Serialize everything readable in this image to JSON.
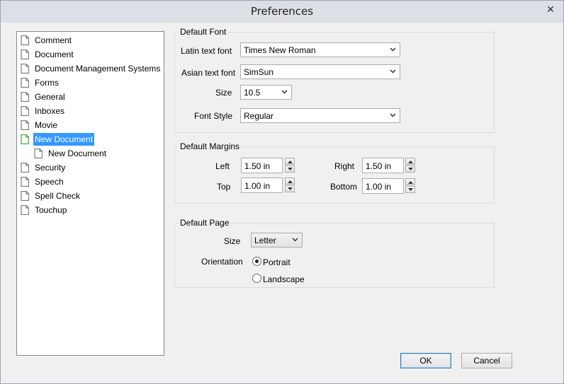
{
  "window": {
    "title": "Preferences",
    "close_glyph": "✕"
  },
  "tree": {
    "items": [
      {
        "label": "Comment"
      },
      {
        "label": "Document"
      },
      {
        "label": "Document Management Systems"
      },
      {
        "label": "Forms"
      },
      {
        "label": "General"
      },
      {
        "label": "Inboxes"
      },
      {
        "label": "Movie"
      },
      {
        "label": "New Document",
        "selected": true
      },
      {
        "label": "New Document",
        "child": true
      },
      {
        "label": "Security"
      },
      {
        "label": "Speech"
      },
      {
        "label": "Spell Check"
      },
      {
        "label": "Touchup"
      }
    ]
  },
  "default_font": {
    "legend": "Default Font",
    "latin_label": "Latin text font",
    "latin_value": "Times New Roman",
    "asian_label": "Asian text font",
    "asian_value": "SimSun",
    "size_label": "Size",
    "size_value": "10.5",
    "style_label": "Font Style",
    "style_value": "Regular"
  },
  "default_margins": {
    "legend": "Default Margins",
    "left_label": "Left",
    "left_value": "1.50 in",
    "right_label": "Right",
    "right_value": "1.50 in",
    "top_label": "Top",
    "top_value": "1.00 in",
    "bottom_label": "Bottom",
    "bottom_value": "1.00 in"
  },
  "default_page": {
    "legend": "Default Page",
    "size_label": "Size",
    "size_value": "Letter",
    "orientation_label": "Orientation",
    "portrait_label": "Portrait",
    "landscape_label": "Landscape",
    "selected_orientation": "Portrait"
  },
  "buttons": {
    "ok": "OK",
    "cancel": "Cancel"
  },
  "colors": {
    "selection": "#3399ff",
    "doc_icon_selected": "#3aa63a"
  }
}
